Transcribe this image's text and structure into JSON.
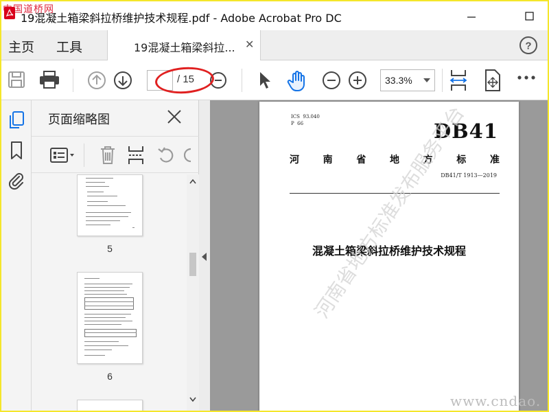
{
  "window": {
    "title": "19混凝土箱梁斜拉桥维护技术规程.pdf - Adobe Acrobat Pro DC",
    "watermark": "中国道桥网"
  },
  "tabs": {
    "home": "主页",
    "tools": "工具",
    "document": "19混凝土箱梁斜拉..."
  },
  "toolbar": {
    "current_page": "",
    "page_count": "/ 15",
    "zoom": "33.3%"
  },
  "thumbnail_panel": {
    "title": "页面缩略图",
    "pages": [
      {
        "number": "5"
      },
      {
        "number": "6"
      }
    ]
  },
  "document": {
    "ics": "ICS  93.040\nP  66",
    "code": "DB41",
    "region_standard": [
      "河",
      "南",
      "省",
      "地",
      "方",
      "标",
      "准"
    ],
    "standard_number": "DB41/T 1913—2019",
    "title": "混凝土箱梁斜拉桥维护技术规程",
    "diagonal_watermark": "河南省地方标准发布服务平台"
  },
  "corner_watermark": "www.cndao.",
  "colors": {
    "outer_border": "#f5e62a",
    "acrobat_red": "#d9001b",
    "rail_icon_blue": "#1473e6",
    "annotation_ellipse": "#e02020"
  }
}
